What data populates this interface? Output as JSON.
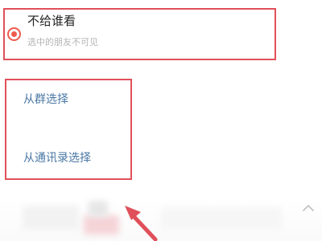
{
  "option": {
    "title": "不给谁看",
    "subtitle": "选中的朋友不可见",
    "selected": true
  },
  "select_actions": {
    "from_group": "从群选择",
    "from_contacts": "从通讯录选择"
  },
  "colors": {
    "accent": "#ee5a4e",
    "highlight": "#e0505a",
    "link": "#4a77a4"
  },
  "icons": {
    "radio": "radio-selected-icon",
    "chevron": "chevron-up-icon",
    "pointer": "red-arrow-icon"
  }
}
